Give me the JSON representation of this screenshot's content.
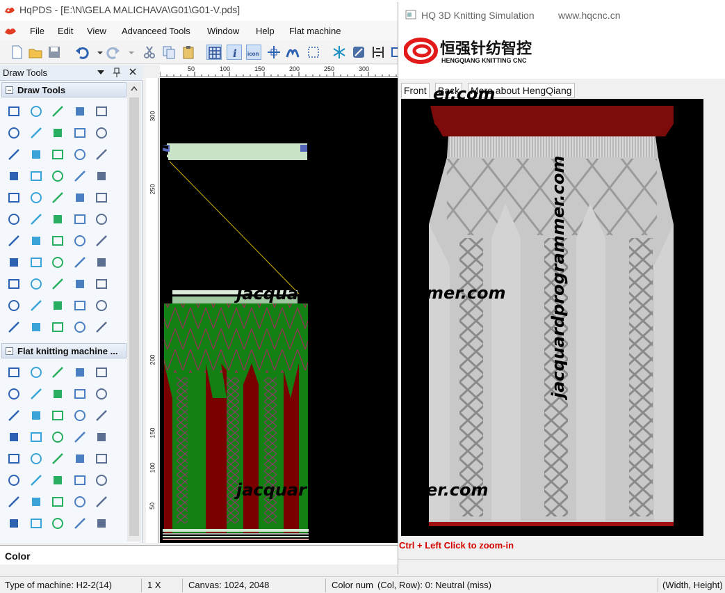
{
  "window": {
    "title": "HqPDS - [E:\\N\\GELA MALICHAVA\\G01\\G01-V.pds]"
  },
  "menu": [
    "File",
    "Edit",
    "View",
    "Advanceed Tools",
    "Window",
    "Help",
    "Flat machine"
  ],
  "toolbar": {
    "icons": [
      "new-file-icon",
      "open-folder-icon",
      "save-icon",
      "undo-icon",
      "redo-icon",
      "cut-icon",
      "copy-icon",
      "paste-icon",
      "grid-icon",
      "info-icon",
      "icon-icon",
      "move-icon",
      "wave-icon",
      "select-icon",
      "snowflake-icon",
      "shield-icon",
      "press-icon",
      "crop-icon"
    ],
    "icon_label": "icon"
  },
  "draw_tools_panel": {
    "title": "Draw Tools",
    "group_draw": "Draw Tools",
    "group_flat": "Flat knitting machine ..."
  },
  "rulers": {
    "top": [
      "50",
      "100",
      "150",
      "200",
      "250",
      "300"
    ],
    "left": [
      "300",
      "250",
      "200",
      "150",
      "100",
      "50"
    ]
  },
  "watermark": "jacquardprogrammer.com",
  "canvas_partial_text": {
    "a": "jacquar",
    "b": "er.com",
    "c": "jacquar",
    "d": "mer.com",
    "e": "jacquar",
    "f": "er.com"
  },
  "color_bar": {
    "label": "Color"
  },
  "status": {
    "machine": "Type of machine: H2-2(14)",
    "zoom": "1 X",
    "canvas": "Canvas: 1024, 2048",
    "color_num": "Color num",
    "colrow": "(Col, Row): 0: Neutral (miss)",
    "wh": "(Width, Height)"
  },
  "simulation": {
    "title": "HQ 3D Knitting Simulation",
    "url": "www.hqcnc.cn",
    "logo_cn": "恒强针纺智控",
    "logo_en": "HENGQIANG KNITTING CNC",
    "tabs": [
      "Front",
      "Back",
      "More about HengQiang"
    ],
    "hint": "Ctrl + Left Click to zoom-in"
  },
  "colors": {
    "fabric_green": "#128012",
    "fabric_red": "#7a0000",
    "rib_light": "#c9e3c9",
    "sim_red": "#7d0b0b",
    "sim_gray": "#c8c8c8",
    "logo_red": "#e21a1a"
  }
}
